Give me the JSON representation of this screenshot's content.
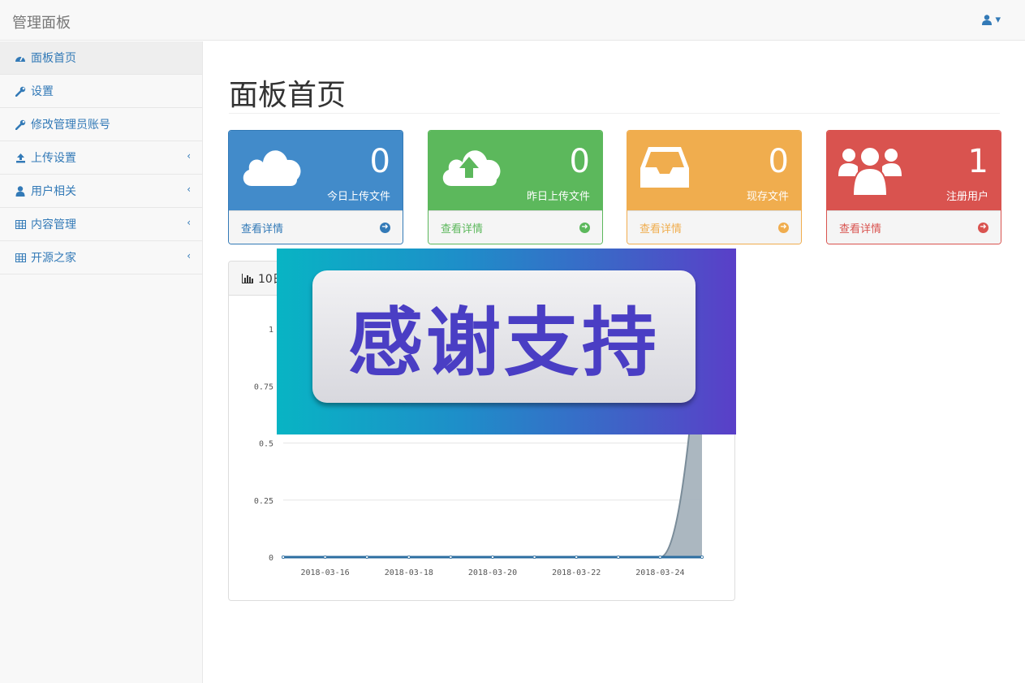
{
  "topbar": {
    "brand": "管理面板",
    "user_icon": "user-icon",
    "caret": "▾"
  },
  "sidebar": {
    "items": [
      {
        "label": "面板首页",
        "icon": "dashboard-icon",
        "active": true,
        "has_children": false
      },
      {
        "label": "设置",
        "icon": "wrench-icon",
        "active": false,
        "has_children": false
      },
      {
        "label": "修改管理员账号",
        "icon": "wrench-icon",
        "active": false,
        "has_children": false
      },
      {
        "label": "上传设置",
        "icon": "upload-icon",
        "active": false,
        "has_children": true
      },
      {
        "label": "用户相关",
        "icon": "user-icon",
        "active": false,
        "has_children": true
      },
      {
        "label": "内容管理",
        "icon": "table-icon",
        "active": false,
        "has_children": true
      },
      {
        "label": "开源之家",
        "icon": "table-icon",
        "active": false,
        "has_children": true
      }
    ]
  },
  "main": {
    "title": "面板首页",
    "cards": [
      {
        "value": "0",
        "label": "今日上传文件",
        "link": "查看详情",
        "icon": "cloud-icon",
        "color": "#428bca",
        "dark": "#337ab7"
      },
      {
        "value": "0",
        "label": "昨日上传文件",
        "link": "查看详情",
        "icon": "cloud-upload-icon",
        "color": "#5cb85c",
        "dark": "#3c763d"
      },
      {
        "value": "0",
        "label": "现存文件",
        "link": "查看详情",
        "icon": "inbox-icon",
        "color": "#f0ad4e",
        "dark": "#eea236"
      },
      {
        "value": "1",
        "label": "注册用户",
        "link": "查看详情",
        "icon": "users-icon",
        "color": "#d9534f",
        "dark": "#a94442"
      }
    ],
    "chart_panel": {
      "title": "10日"
    }
  },
  "overlay": {
    "text": "感谢支持"
  },
  "chart_data": {
    "type": "area",
    "x": [
      "2018-03-15",
      "2018-03-16",
      "2018-03-17",
      "2018-03-18",
      "2018-03-19",
      "2018-03-20",
      "2018-03-21",
      "2018-03-22",
      "2018-03-23",
      "2018-03-24",
      "2018-03-25"
    ],
    "xticks": [
      "2018-03-16",
      "2018-03-18",
      "2018-03-20",
      "2018-03-22",
      "2018-03-24"
    ],
    "series": [
      {
        "values": [
          0,
          0,
          0,
          0,
          0,
          0,
          0,
          0,
          0,
          0,
          1
        ],
        "color": "#a7b3bd",
        "stroke": "#7a8c99"
      },
      {
        "values": [
          0,
          0,
          0,
          0,
          0,
          0,
          0,
          0,
          0,
          0,
          0
        ],
        "color": "#2c6ea1",
        "stroke": "#2c6ea1"
      }
    ],
    "yticks": [
      "0",
      "0.25",
      "0.5",
      "0.75",
      "1"
    ],
    "ylim": [
      0,
      1
    ],
    "grid": true
  }
}
